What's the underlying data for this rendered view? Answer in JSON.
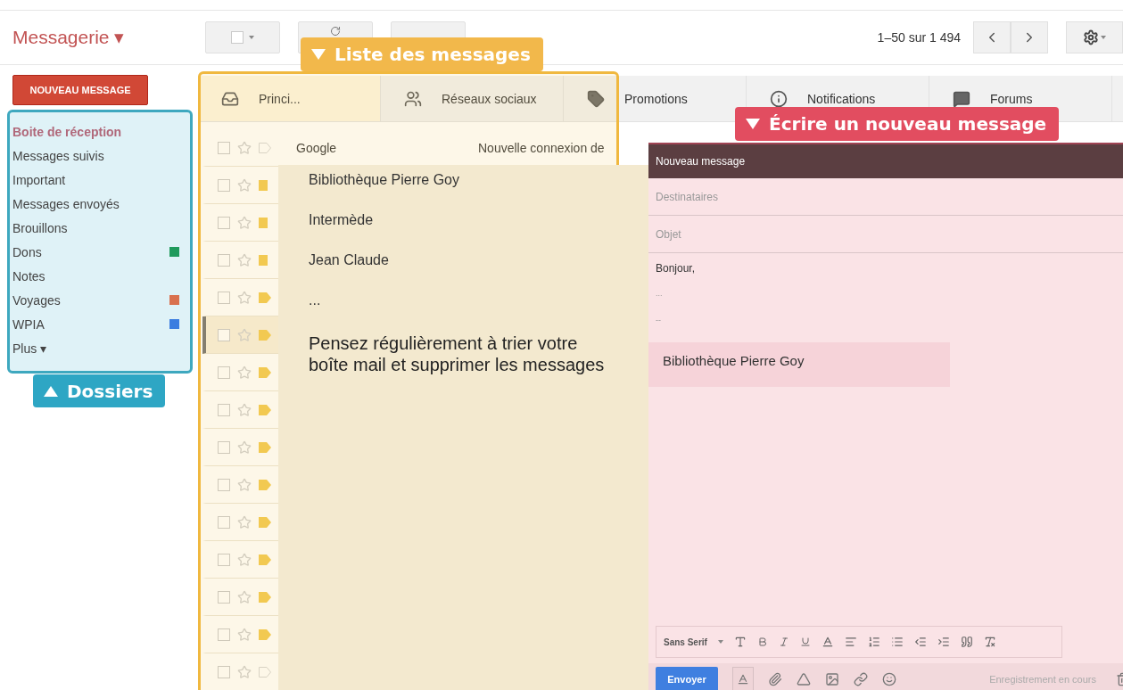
{
  "app_title": "Messagerie ▾",
  "pagination": "1–50 sur 1 494",
  "compose_button": "NOUVEAU MESSAGE",
  "folders": [
    {
      "label": "Boite de réception",
      "selected": true
    },
    {
      "label": "Messages suivis",
      "selected": false
    },
    {
      "label": "Important",
      "selected": false
    },
    {
      "label": "Messages envoyés",
      "selected": false
    },
    {
      "label": "Brouillons",
      "selected": false
    },
    {
      "label": "Dons",
      "selected": false,
      "color": "#1f9a5c"
    },
    {
      "label": "Notes",
      "selected": false
    },
    {
      "label": "Voyages",
      "selected": false,
      "color": "#d9714e"
    },
    {
      "label": "WPIA",
      "selected": false,
      "color": "#3b7de0"
    },
    {
      "label": "Plus ▾",
      "selected": false
    }
  ],
  "folders_callout": {
    "label": "Dossiers"
  },
  "list_callout": {
    "label": "Liste des messages"
  },
  "compose_callout": {
    "label": "Écrire un nouveau message"
  },
  "tabs": [
    {
      "label": "Princi...",
      "selected": true
    },
    {
      "label": "Réseaux sociaux",
      "selected": false
    },
    {
      "label": "Promotions",
      "selected": false
    },
    {
      "label": "Notifications",
      "selected": false
    },
    {
      "label": "Forums",
      "selected": false
    }
  ],
  "messages": [
    {
      "kind": "plain",
      "focused": false,
      "sender": "Google",
      "subject": "Nouvelle connexion de"
    },
    {
      "kind": "square",
      "focused": false
    },
    {
      "kind": "square",
      "focused": false
    },
    {
      "kind": "square",
      "focused": false
    },
    {
      "kind": "tag",
      "focused": false
    },
    {
      "kind": "tag",
      "focused": true
    },
    {
      "kind": "tag",
      "focused": false
    },
    {
      "kind": "tag",
      "focused": false
    },
    {
      "kind": "tag",
      "focused": false
    },
    {
      "kind": "tag",
      "focused": false
    },
    {
      "kind": "tag",
      "focused": false
    },
    {
      "kind": "tag",
      "focused": false
    },
    {
      "kind": "tag",
      "focused": false
    },
    {
      "kind": "tag",
      "focused": false
    },
    {
      "kind": "plain",
      "focused": false
    }
  ],
  "list_overlay": {
    "senders": [
      "Bibliothèque Pierre Goy",
      "Intermède",
      "Jean Claude",
      "..."
    ],
    "note": "Pensez régulièrement à trier votre boîte mail et supprimer les messages"
  },
  "compose": {
    "title": "Nouveau message",
    "to": {
      "placeholder": "Destinataires"
    },
    "subject": {
      "placeholder": "Objet"
    },
    "body_lines": [
      "Bonjour,",
      "...",
      "--"
    ],
    "signature": "Bibliothèque Pierre Goy",
    "font": "Sans Serif",
    "send": "Envoyer",
    "status": "Enregistrement en cours"
  }
}
